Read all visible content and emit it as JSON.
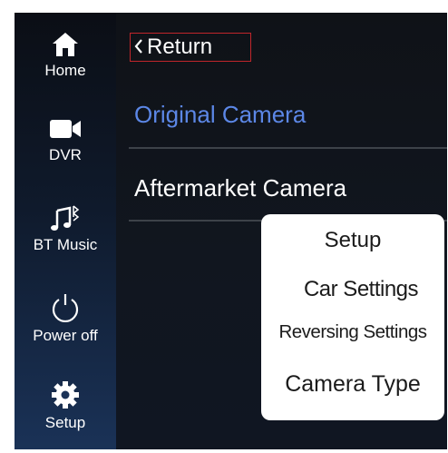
{
  "sidebar": {
    "items": [
      {
        "label": "Home",
        "icon": "home-icon"
      },
      {
        "label": "DVR",
        "icon": "video-camera-icon"
      },
      {
        "label": "BT Music",
        "icon": "bluetooth-music-icon"
      },
      {
        "label": "Power off",
        "icon": "power-icon"
      },
      {
        "label": "Setup",
        "icon": "gear-icon"
      }
    ]
  },
  "header": {
    "return_label": "Return",
    "return_border_color": "#c0262b"
  },
  "main": {
    "options": [
      {
        "label": "Original Camera",
        "color": "#5c87e6"
      },
      {
        "label": "Aftermarket Camera",
        "color": "#ffffff"
      }
    ]
  },
  "popup": {
    "lines": [
      "Setup",
      "Car Settings",
      "Reversing Settings",
      "Camera Type"
    ]
  }
}
